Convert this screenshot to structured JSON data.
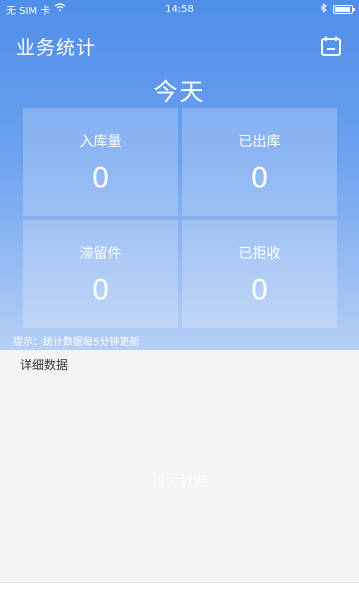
{
  "status_bar": {
    "carrier": "无 SIM 卡",
    "time": "14:58"
  },
  "header": {
    "title": "业务统计",
    "calendar_icon": "calendar-icon"
  },
  "period": "今天",
  "stats": [
    {
      "label": "入库量",
      "value": "0"
    },
    {
      "label": "已出库",
      "value": "0"
    },
    {
      "label": "滞留件",
      "value": "0"
    },
    {
      "label": "已拒收",
      "value": "0"
    }
  ],
  "hint": "提示：统计数据每5分钟更新",
  "detail": {
    "heading": "详细数据",
    "empty_text": "暂无数据"
  },
  "colors": {
    "primary": "#4f8ee9",
    "gradient_end": "#b6d0f6"
  }
}
